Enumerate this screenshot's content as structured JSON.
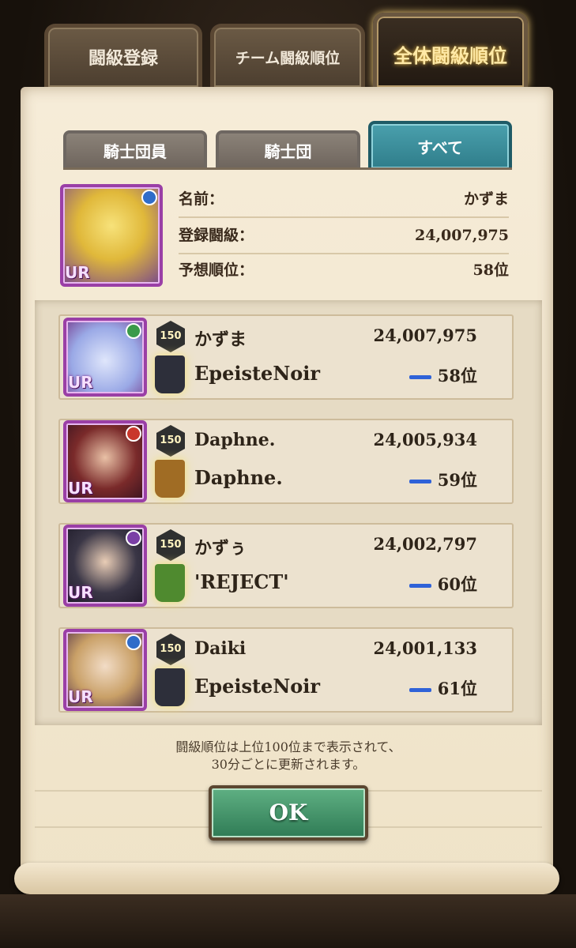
{
  "top_tabs": [
    "闘級登録",
    "チーム闘級順位",
    "全体闘級順位"
  ],
  "sub_tabs": [
    "騎士団員",
    "騎士団",
    "すべて"
  ],
  "my_info": {
    "rows": [
      {
        "label": "名前：",
        "value": "かずま"
      },
      {
        "label": "登録闘級：",
        "value": "24,007,975"
      },
      {
        "label": "予想順位：",
        "value": "58位"
      }
    ],
    "rarity": "UR"
  },
  "ranking": [
    {
      "level": "150",
      "name": "かずま",
      "score": "24,007,975",
      "guild": "EpeisteNoir",
      "rank": "58位",
      "rarity": "UR",
      "attr_color": "#3a9a4a",
      "avatar_color": "#b9c6f0",
      "banner_color": "#2d2f3a"
    },
    {
      "level": "150",
      "name": "Daphne.",
      "score": "24,005,934",
      "guild": "Daphne.",
      "rank": "59位",
      "rarity": "UR",
      "attr_color": "#c9372c",
      "avatar_color": "#6a2a2a",
      "banner_color": "#a06c24"
    },
    {
      "level": "150",
      "name": "かずぅ",
      "score": "24,002,797",
      "guild": "'REJECT'",
      "rank": "60位",
      "rarity": "UR",
      "attr_color": "#7a3fa6",
      "avatar_color": "#2e2b3a",
      "banner_color": "#4f8a2f"
    },
    {
      "level": "150",
      "name": "Daiki",
      "score": "24,001,133",
      "guild": "EpeisteNoir",
      "rank": "61位",
      "rarity": "UR",
      "attr_color": "#2f6cc9",
      "avatar_color": "#c9a067",
      "banner_color": "#2d2f3a"
    }
  ],
  "note_line1": "闘級順位は上位100位まで表示されて、",
  "note_line2": "30分ごとに更新されます。",
  "ok_label": "OK"
}
